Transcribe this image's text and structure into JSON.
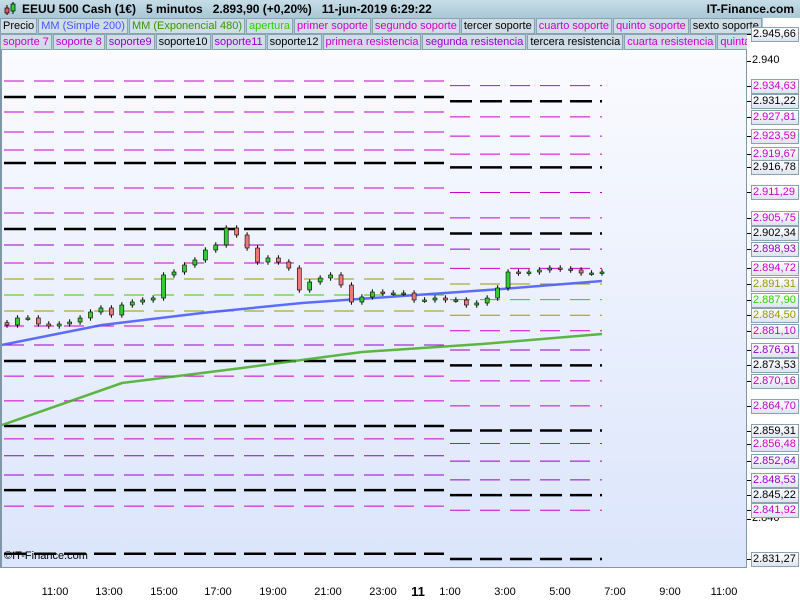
{
  "header": {
    "title": "EEUU 500 Cash (1€)   5 minutos   2.893,90 (+0,20%)   11-jun-2019 6:29:22",
    "brand": "IT-Finance.com",
    "icon": "candlestick-icon"
  },
  "legend_row1": [
    {
      "label": "Precio",
      "color": "#000000"
    },
    {
      "label": "MM (Simple 200)",
      "color": "#4455ff"
    },
    {
      "label": "MM (Exponencial 480)",
      "color": "#339900"
    },
    {
      "label": "apertura",
      "color": "#33cc00"
    },
    {
      "label": "primer soporte",
      "color": "#cc00cc"
    },
    {
      "label": "segundo soporte",
      "color": "#cc00cc"
    },
    {
      "label": "tercer soporte",
      "color": "#000000"
    },
    {
      "label": "cuarto soporte",
      "color": "#cc00cc"
    },
    {
      "label": "quinto soporte",
      "color": "#cc00cc"
    },
    {
      "label": "sexto soporte",
      "color": "#000000"
    }
  ],
  "legend_row2": [
    {
      "label": "soporte 7",
      "color": "#cc00cc"
    },
    {
      "label": "soporte 8",
      "color": "#bb00cc"
    },
    {
      "label": "soporte9",
      "color": "#9900cc"
    },
    {
      "label": "soporte10",
      "color": "#000000"
    },
    {
      "label": "soporte11",
      "color": "#9900cc"
    },
    {
      "label": "soporte12",
      "color": "#000000"
    },
    {
      "label": "primera resistencia",
      "color": "#cc00cc"
    },
    {
      "label": "segunda resistencia",
      "color": "#9900cc"
    },
    {
      "label": "tercera resistencia",
      "color": "#000000"
    },
    {
      "label": "cuarta resistencia",
      "color": "#cc00cc"
    },
    {
      "label": "quinta res",
      "color": "#cc00cc"
    }
  ],
  "copyright": "©IT-Finance.com",
  "chart_data": {
    "type": "candlestick",
    "ylim": [
      2830,
      2950
    ],
    "y_ticks": [
      "2.940",
      "2.840"
    ],
    "top_label": "2.945,66",
    "x_ticks": [
      "11:00",
      "13:00",
      "15:00",
      "17:00",
      "19:00",
      "21:00",
      "23:00",
      "11",
      "1:00",
      "3:00",
      "5:00",
      "7:00",
      "9:00",
      "11:00"
    ],
    "price_close": [
      2882.36,
      2883.89,
      2883.89,
      2882.58,
      2882.14,
      2882.58,
      2883.01,
      2883.89,
      2885.2,
      2886.08,
      2884.54,
      2886.72,
      2887.38,
      2887.82,
      2888.25,
      2893.28,
      2893.93,
      2895.46,
      2896.55,
      2898.73,
      2899.83,
      2903.54,
      2902.01,
      2899.17,
      2896.11,
      2896.99,
      2896.11,
      2894.8,
      2890.0,
      2891.75,
      2892.62,
      2893.28,
      2891.09,
      2887.38,
      2888.47,
      2889.56,
      2889.34,
      2889.34,
      2889.34,
      2887.82,
      2887.82,
      2888.25,
      2887.82,
      2887.82,
      2886.72,
      2887.16,
      2888.25,
      2890.44,
      2893.93,
      2893.71,
      2893.93,
      2894.37,
      2894.8,
      2894.59,
      2894.37,
      2893.71,
      2893.71,
      2893.93
    ],
    "sma200": [
      2878.0,
      2882.36,
      2884.98,
      2887.16,
      2888.69,
      2890.22,
      2891.97
    ],
    "ema480": [
      2860.52,
      2869.69,
      2872.97,
      2876.46,
      2878.21,
      2880.39
    ],
    "levels_previous_day": [
      2935.63,
      2932.14,
      2928.86,
      2924.5,
      2920.57,
      2917.73,
      2912.27,
      2906.81,
      2903.32,
      2899.83,
      2895.9,
      2892.41,
      2888.91,
      2885.42,
      2882.14,
      2878.0,
      2874.5,
      2871.2,
      2865.8,
      2860.3,
      2857.5,
      2853.8,
      2849.6,
      2846.3,
      2842.8,
      2832.4
    ],
    "levels_current": [
      {
        "value": 2934.63,
        "label": "2.934,63",
        "color": "#cc00cc",
        "style": "thin"
      },
      {
        "value": 2931.22,
        "label": "2.931,22",
        "color": "#000000",
        "style": "thick"
      },
      {
        "value": 2927.81,
        "label": "2.927,81",
        "color": "#cc00cc",
        "style": "thin"
      },
      {
        "value": 2923.59,
        "label": "2.923,59",
        "color": "#cc00cc",
        "style": "thin"
      },
      {
        "value": 2919.67,
        "label": "2.919,67",
        "color": "#cc00cc",
        "style": "thin"
      },
      {
        "value": 2916.78,
        "label": "2.916,78",
        "color": "#000000",
        "style": "thick"
      },
      {
        "value": 2911.29,
        "label": "2.911,29",
        "color": "#cc00cc",
        "style": "thin"
      },
      {
        "value": 2905.75,
        "label": "2.905,75",
        "color": "#cc00cc",
        "style": "thin"
      },
      {
        "value": 2902.34,
        "label": "2.902,34",
        "color": "#000000",
        "style": "thick"
      },
      {
        "value": 2898.93,
        "label": "2.898,93",
        "color": "#9900cc",
        "style": "thin"
      },
      {
        "value": 2894.72,
        "label": "2.894,72",
        "color": "#cc00cc",
        "style": "thin"
      },
      {
        "value": 2891.31,
        "label": "2.891,31",
        "color": "#999900",
        "style": "thin"
      },
      {
        "value": 2887.9,
        "label": "2.887,90",
        "color": "#33cc00",
        "style": "thin"
      },
      {
        "value": 2884.5,
        "label": "2.884,50",
        "color": "#999900",
        "style": "thin"
      },
      {
        "value": 2881.1,
        "label": "2.881,10",
        "color": "#cc00cc",
        "style": "thin"
      },
      {
        "value": 2876.91,
        "label": "2.876,91",
        "color": "#9900cc",
        "style": "thin"
      },
      {
        "value": 2873.53,
        "label": "2.873,53",
        "color": "#000000",
        "style": "thick"
      },
      {
        "value": 2870.16,
        "label": "2.870,16",
        "color": "#cc00cc",
        "style": "thin"
      },
      {
        "value": 2864.7,
        "label": "2.864,70",
        "color": "#cc00cc",
        "style": "thin"
      },
      {
        "value": 2859.31,
        "label": "2.859,31",
        "color": "#000000",
        "style": "thick"
      },
      {
        "value": 2856.48,
        "label": "2.856,48",
        "color": "#cc00cc",
        "style": "thin"
      },
      {
        "value": 2852.64,
        "label": "2.852,64",
        "color": "#9900cc",
        "style": "thin"
      },
      {
        "value": 2848.53,
        "label": "2.848,53",
        "color": "#9900cc",
        "style": "thin"
      },
      {
        "value": 2845.22,
        "label": "2.845,22",
        "color": "#000000",
        "style": "thick"
      },
      {
        "value": 2841.92,
        "label": "2.841,92",
        "color": "#cc00cc",
        "style": "thin"
      },
      {
        "value": 2831.27,
        "label": "2.831,27",
        "color": "#000000",
        "style": "thick"
      }
    ],
    "colors": {
      "up": "#33cc33",
      "down": "#ee7777",
      "sma": "#4455ff",
      "ema": "#44aa22"
    }
  }
}
